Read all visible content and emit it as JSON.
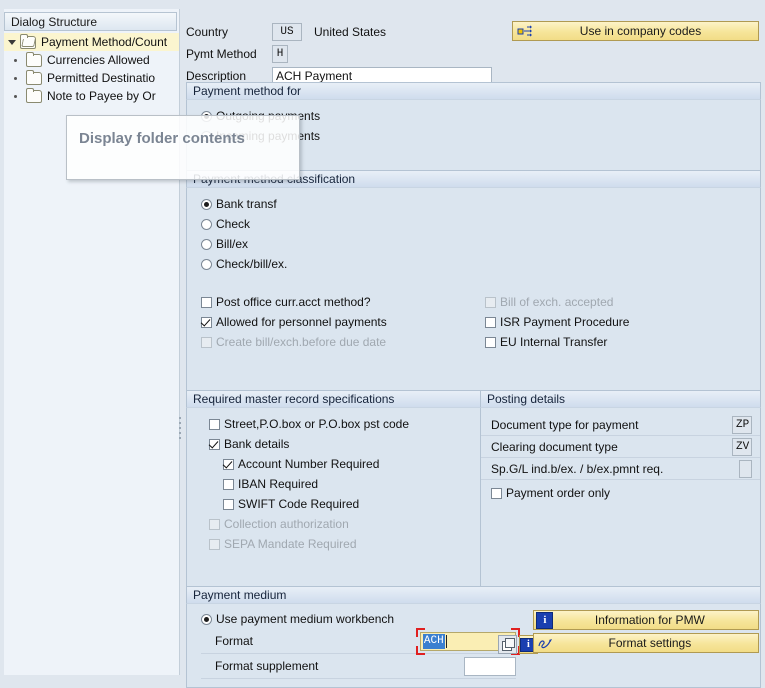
{
  "tree": {
    "header": "Dialog Structure",
    "items": [
      {
        "label": "Payment Method/Count",
        "level": 0,
        "expanded": true,
        "selected": true,
        "icon": "folder-open-icon"
      },
      {
        "label": "Currencies Allowed",
        "level": 1,
        "expanded": false,
        "selected": false,
        "icon": "folder-icon"
      },
      {
        "label": "Permitted Destinatio",
        "level": 1,
        "expanded": false,
        "selected": false,
        "icon": "folder-icon"
      },
      {
        "label": "Note to Payee by Or",
        "level": 1,
        "expanded": false,
        "selected": false,
        "icon": "folder-icon"
      }
    ]
  },
  "tooltip": {
    "text": "Display folder contents"
  },
  "header": {
    "country_label": "Country",
    "country_value": "US",
    "country_name": "United States",
    "pymt_method_label": "Pymt Method",
    "pymt_method_value": "H",
    "description_label": "Description",
    "description_value": "ACH Payment",
    "use_in_company_codes_button": "Use in company codes"
  },
  "payment_method_for": {
    "title": "Payment method for",
    "options": [
      {
        "label": "Outgoing payments",
        "selected": true
      },
      {
        "label": "Incoming payments",
        "selected": false
      }
    ]
  },
  "classification": {
    "title": "Payment method classification",
    "options": [
      {
        "label": "Bank transf",
        "selected": true
      },
      {
        "label": "Check",
        "selected": false
      },
      {
        "label": "Bill/ex",
        "selected": false
      },
      {
        "label": "Check/bill/ex.",
        "selected": false
      }
    ],
    "checkboxes_left": [
      {
        "label": "Post office curr.acct method?",
        "checked": false,
        "disabled": false
      },
      {
        "label": "Allowed for personnel payments",
        "checked": true,
        "disabled": false
      },
      {
        "label": "Create bill/exch.before due date",
        "checked": false,
        "disabled": true
      }
    ],
    "checkboxes_right": [
      {
        "label": "Bill of exch. accepted",
        "checked": false,
        "disabled": true
      },
      {
        "label": "ISR Payment Procedure",
        "checked": false,
        "disabled": false
      },
      {
        "label": "EU Internal Transfer",
        "checked": false,
        "disabled": false
      }
    ]
  },
  "master_record": {
    "title": "Required master record specifications",
    "items": [
      {
        "label": "Street,P.O.box or P.O.box pst code",
        "checked": false,
        "disabled": false,
        "indent": 0
      },
      {
        "label": "Bank details",
        "checked": true,
        "disabled": false,
        "indent": 0
      },
      {
        "label": "Account Number Required",
        "checked": true,
        "disabled": false,
        "indent": 1
      },
      {
        "label": "IBAN Required",
        "checked": false,
        "disabled": false,
        "indent": 1
      },
      {
        "label": "SWIFT Code Required",
        "checked": false,
        "disabled": false,
        "indent": 1
      },
      {
        "label": "Collection authorization",
        "checked": false,
        "disabled": true,
        "indent": 0
      },
      {
        "label": "SEPA Mandate Required",
        "checked": false,
        "disabled": true,
        "indent": 0
      }
    ]
  },
  "posting_details": {
    "title": "Posting details",
    "fields": [
      {
        "label": "Document type for payment",
        "value": "ZP"
      },
      {
        "label": "Clearing document type",
        "value": "ZV"
      },
      {
        "label": "Sp.G/L ind.b/ex. / b/ex.pmnt req.",
        "value": ""
      }
    ],
    "checkbox": {
      "label": "Payment order only",
      "checked": false
    }
  },
  "payment_medium": {
    "title": "Payment medium",
    "use_pmw_label": "Use payment medium workbench",
    "use_pmw_selected": true,
    "format_label": "Format",
    "format_value": "ACH",
    "format_supplement_label": "Format supplement",
    "format_supplement_value": "",
    "info_pmw_button": "Information for PMW",
    "format_settings_button": "Format settings"
  },
  "colors": {
    "page_bg": "#dfe6ee",
    "panel_bg": "#dbe5ef",
    "accent_yellow": "#f6e59a",
    "focus_red": "#e02020",
    "selection_blue": "#3a7fd0",
    "tree_selected": "#fbf5cf"
  }
}
